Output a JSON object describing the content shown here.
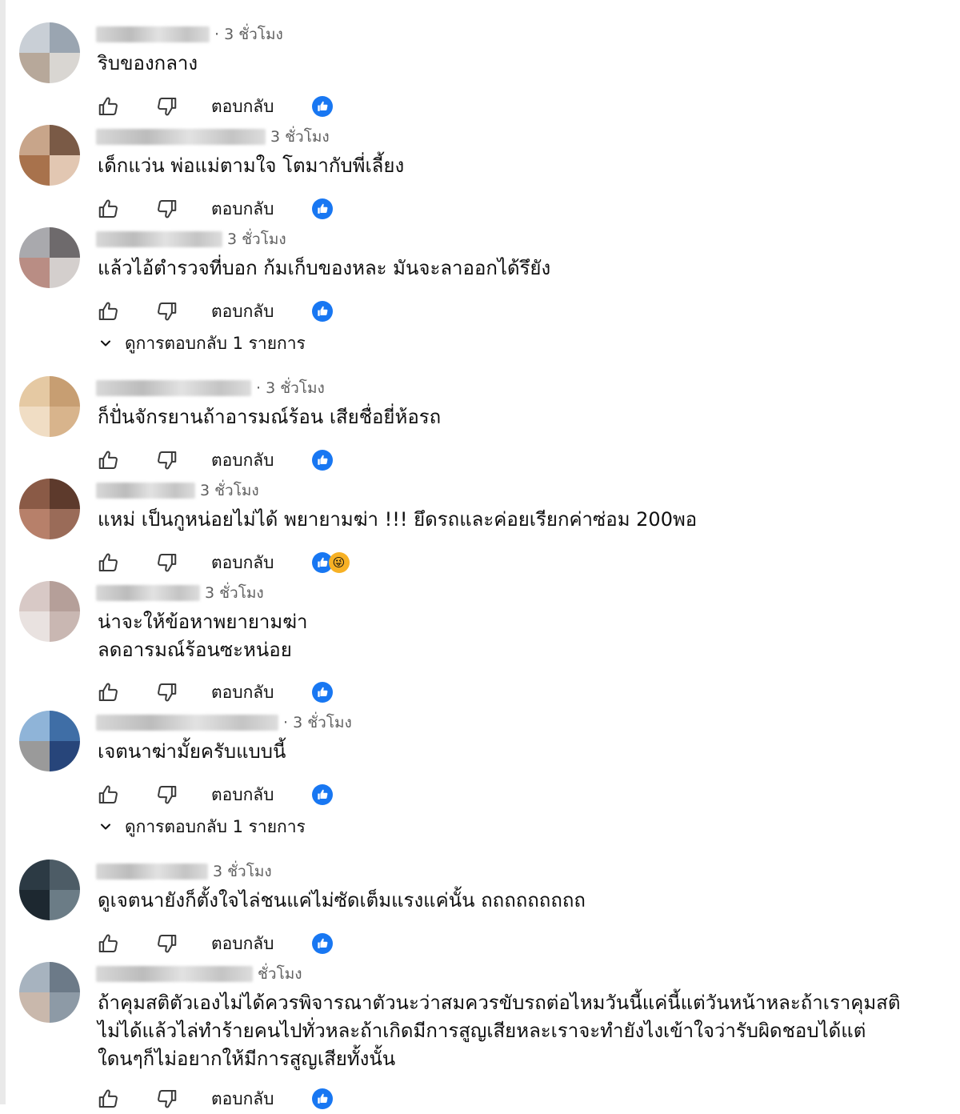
{
  "labels": {
    "reply": "ตอบกลับ",
    "view_replies": "ดูการตอบกลับ 1 รายการ"
  },
  "colors": {
    "like_badge_blue": "#1877f2",
    "icon_gray": "#3a3a3a",
    "time_gray": "#606060"
  },
  "comments": [
    {
      "time": "· 3 ชั่วโมง",
      "text": "ริบของกลาง",
      "reaction_icons": [
        "like-icon"
      ],
      "avatar_colors": [
        "#c9cfd6",
        "#9aa5b1",
        "#b7a89a",
        "#d9d6d2"
      ]
    },
    {
      "time": "3 ชั่วโมง",
      "text": "เด็กแว่น พ่อแม่ตามใจ โตมากับพี่เลี้ยง",
      "reaction_icons": [
        "like-icon"
      ],
      "avatar_colors": [
        "#c8a58a",
        "#7a5a46",
        "#a8724c",
        "#e2c7b2"
      ]
    },
    {
      "time": "3 ชั่วโมง",
      "text": "แล้วไอ้ตำรวจที่บอก ก้มเก็บของหละ มันจะลาออกได้รึยัง",
      "reaction_icons": [
        "like-icon"
      ],
      "avatar_colors": [
        "#a9a9ad",
        "#6e6a6c",
        "#b98d84",
        "#d4cfcd"
      ],
      "view_replies": true
    },
    {
      "time": "· 3 ชั่วโมง",
      "text": "ก็ปั่นจักรยานถ้าอารมณ์ร้อน เสียชื่อยี่ห้อรถ",
      "reaction_icons": [
        "like-icon"
      ],
      "avatar_colors": [
        "#e5c9a3",
        "#c79e72",
        "#f0ddc4",
        "#d8b48c"
      ]
    },
    {
      "time": "3 ชั่วโมง",
      "text": "แหม่ เป็นกูหน่อยไม่ได้ พยายามฆ่า !!! ยึดรถและค่อยเรียกค่าซ่อม 200พอ",
      "reaction_icons": [
        "like-icon",
        "laughing-emoji-icon"
      ],
      "avatar_colors": [
        "#8a5a46",
        "#5d3a2c",
        "#b7806a",
        "#9a6b58"
      ]
    },
    {
      "time": "3 ชั่วโมง",
      "text": "น่าจะให้ข้อหาพยายามฆ่า\nลดอารมณ์ร้อนซะหน่อย",
      "reaction_icons": [
        "like-icon"
      ],
      "avatar_colors": [
        "#d8c9c6",
        "#b59f99",
        "#e9e2e0",
        "#c9b7b2"
      ]
    },
    {
      "time": "· 3 ชั่วโมง",
      "text": "เจตนาฆ่ามั้ยครับแบบนี้",
      "reaction_icons": [
        "like-icon"
      ],
      "avatar_colors": [
        "#8fb4d8",
        "#3f6ea6",
        "#9a9a9a",
        "#27457a"
      ],
      "view_replies": true
    },
    {
      "time": "3 ชั่วโมง",
      "text": "ดูเจตนายังก็ตั้งใจไล่ชนแค่ไม่ซัดเต็มแรงแค่นั้น ถถถถถถถถถ",
      "reaction_icons": [
        "like-icon"
      ],
      "avatar_colors": [
        "#2c3a44",
        "#4d5c66",
        "#1d2830",
        "#6b7c86"
      ]
    },
    {
      "time": "ชั่วโมง",
      "text": "ถ้าคุมสติตัวเองไม่ได้ควรพิจารณาตัวนะว่าสมควรขับรถต่อไหมวันนี้แค่นี้แต่วันหน้าหละถ้าเราคุมสติ\nไม่ได้แล้วไล่ทำร้ายคนไปทั่วหละถ้าเกิดมีการสูญเสียหละเราจะทำยังไงเข้าใจว่ารับผิดชอบได้แต่\nใดนๆก็ไม่อยากให้มีการสูญเสียทั้งนั้น",
      "reaction_icons": [
        "like-icon"
      ],
      "avatar_colors": [
        "#a7b3bf",
        "#6c7a88",
        "#c9b8ac",
        "#8d9aa6"
      ]
    }
  ]
}
